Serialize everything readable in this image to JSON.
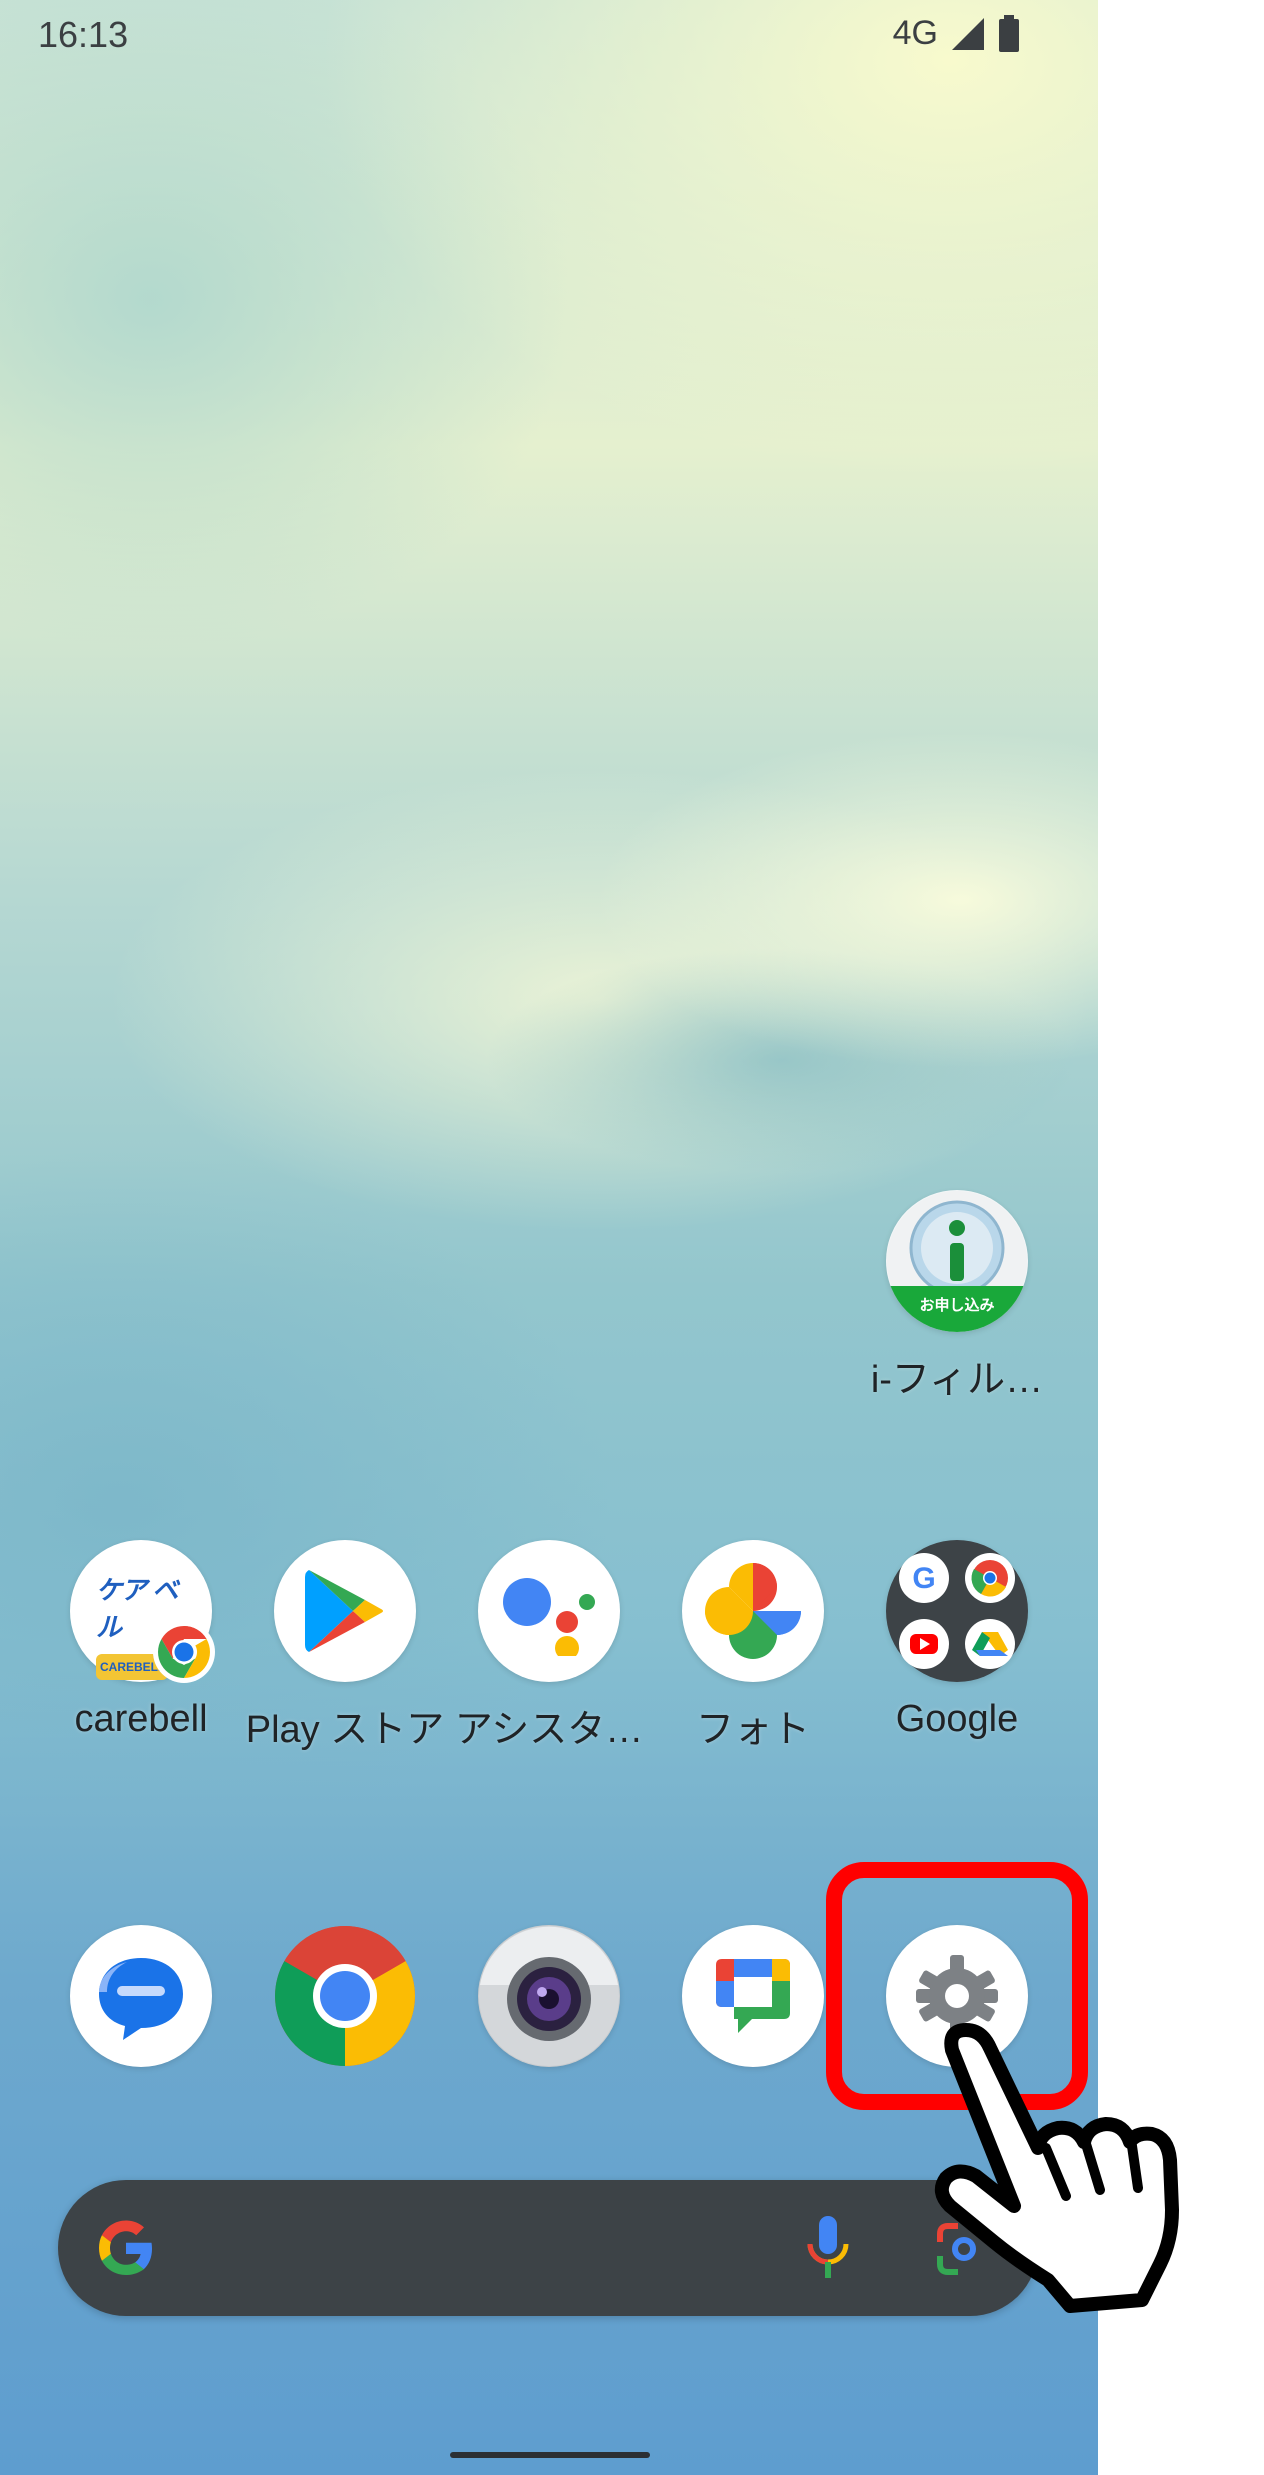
{
  "status_bar": {
    "time": "16:13",
    "network": "4G",
    "signal_icon": "signal-icon",
    "battery_icon": "battery-icon"
  },
  "home_apps": {
    "ifilter": {
      "label": "i-フィル…",
      "badge_text": "お申し込み",
      "icon": "i-filter-icon"
    },
    "row1": [
      {
        "label": "carebell",
        "icon": "carebell-icon",
        "logo_text": "ケア ベル",
        "logo_sub": "CAREBELL"
      },
      {
        "label": "Play ストア",
        "icon": "play-store-icon"
      },
      {
        "label": "アシスタ…",
        "icon": "assistant-icon"
      },
      {
        "label": "フォト",
        "icon": "photos-icon"
      },
      {
        "label": "Google",
        "icon": "google-folder-icon"
      }
    ],
    "dock": [
      {
        "icon": "messages-icon"
      },
      {
        "icon": "chrome-icon"
      },
      {
        "icon": "camera-icon"
      },
      {
        "icon": "google-chat-icon"
      },
      {
        "icon": "settings-icon"
      }
    ]
  },
  "search_bar": {
    "logo_icon": "google-g-icon",
    "mic_icon": "mic-icon",
    "lens_icon": "lens-icon"
  },
  "annotation": {
    "highlight_color": "#ff0000",
    "pointer_icon": "hand-pointer-icon"
  }
}
